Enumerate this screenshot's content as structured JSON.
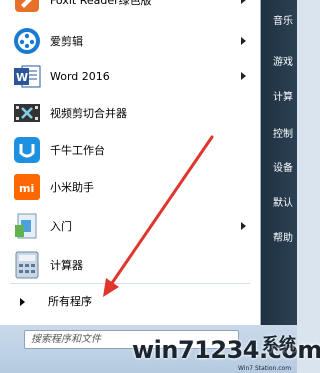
{
  "programs": [
    {
      "label": "Foxit Reader绿色版",
      "icon": "foxit-reader-icon",
      "submenu": true
    },
    {
      "label": "爱剪辑",
      "icon": "aijianji-icon",
      "submenu": true
    },
    {
      "label": "Word 2016",
      "icon": "word-icon",
      "submenu": true
    },
    {
      "label": "视频剪切合并器",
      "icon": "video-cutter-icon",
      "submenu": false
    },
    {
      "label": "千牛工作台",
      "icon": "qianniu-icon",
      "submenu": false
    },
    {
      "label": "小米助手",
      "icon": "mi-assistant-icon",
      "submenu": false
    },
    {
      "label": "入门",
      "icon": "getting-started-icon",
      "submenu": true
    },
    {
      "label": "计算器",
      "icon": "calculator-icon",
      "submenu": false
    }
  ],
  "all_programs": {
    "label": "所有程序"
  },
  "search": {
    "placeholder": "搜索程序和文件"
  },
  "right_menu": [
    "音乐",
    "游戏",
    "计算",
    "控制",
    "设备",
    "默认",
    "帮助"
  ],
  "watermark": {
    "text": "win71234.com",
    "brand": "系统",
    "sub": "Win7 Station.com"
  },
  "colors": {
    "annotation_arrow": "#e0352b",
    "word_blue": "#2b579a",
    "mi_orange": "#ff6700"
  }
}
